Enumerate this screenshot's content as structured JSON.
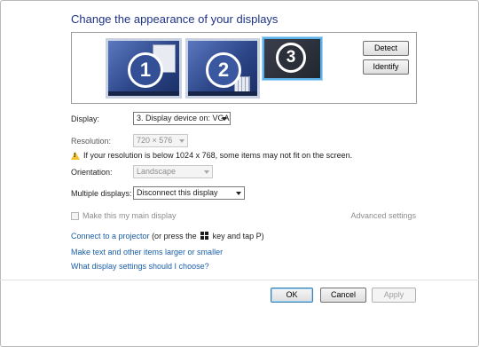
{
  "header": {
    "title": "Change the appearance of your displays"
  },
  "monitors": [
    {
      "number": "1"
    },
    {
      "number": "2"
    },
    {
      "number": "3"
    }
  ],
  "buttons": {
    "detect": "Detect",
    "identify": "Identify",
    "ok": "OK",
    "cancel": "Cancel",
    "apply": "Apply"
  },
  "settings": {
    "display_label": "Display:",
    "display_value": "3. Display device on: VGA",
    "resolution_label": "Resolution:",
    "resolution_value": "720 × 576",
    "warning": "If your resolution is below 1024 x 768, some items may not fit on the screen.",
    "orientation_label": "Orientation:",
    "orientation_value": "Landscape",
    "multiple_label": "Multiple displays:",
    "multiple_value": "Disconnect this display",
    "main_display_checkbox": "Make this my main display",
    "advanced_link": "Advanced settings"
  },
  "links": {
    "projector_link": "Connect to a projector",
    "projector_text_a": " (or press the ",
    "projector_text_b": " key and tap P)",
    "text_size_link": "Make text and other items larger or smaller",
    "help_link": "What display settings should I choose?"
  }
}
